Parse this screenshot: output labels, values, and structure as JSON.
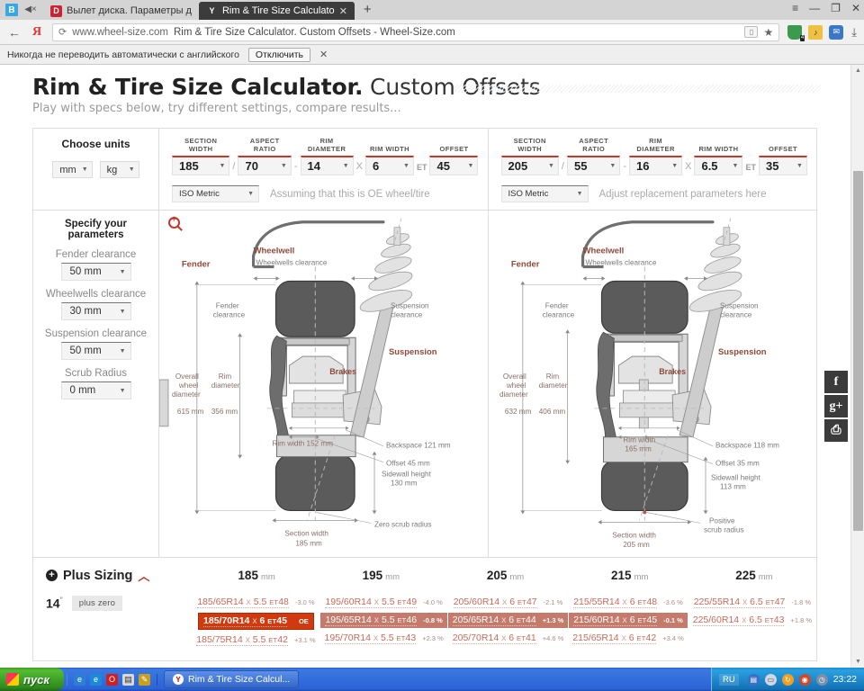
{
  "browser": {
    "tabs": [
      {
        "label": "Вылет диска. Параметры д",
        "favicon": "D",
        "active": false
      },
      {
        "label": "Rim & Tire Size Calculato",
        "favicon": "Y",
        "active": true
      }
    ],
    "new_tab_label": "+",
    "close_glyph": "✕",
    "window_controls": {
      "menu": "≡",
      "minimize": "—",
      "maximize": "❐",
      "close": "✕"
    },
    "back_arrow": "←",
    "yandex_logo": "Я",
    "reload_glyph": "⟳",
    "url_domain": "www.wheel-size.com",
    "url_title": "Rim & Tire Size Calculator. Custom Offsets - Wheel-Size.com",
    "star_glyph": "★",
    "download_glyph": "⤓",
    "extensions": [
      {
        "name": "adblock-shield",
        "glyph": "",
        "badge": "4"
      },
      {
        "name": "notes",
        "glyph": "♪"
      },
      {
        "name": "mail",
        "glyph": "✉"
      }
    ],
    "notice": {
      "text": "Никогда не переводить автоматически с английского",
      "button": "Отключить",
      "close": "✕"
    }
  },
  "header": {
    "title_bold": "Rim & Tire Size Calculator.",
    "title_light": " Custom Offsets",
    "subtitle": "Play with specs below, try different settings, compare results..."
  },
  "units": {
    "title": "Choose units",
    "length": "mm",
    "weight": "kg",
    "caret": "▼"
  },
  "specs": {
    "labels": {
      "section_width": "SECTION WIDTH",
      "aspect_ratio": "ASPECT RATIO",
      "rim_diameter": "RIM DIAMETER",
      "rim_width": "RIM WIDTH",
      "offset": "OFFSET"
    },
    "separators": {
      "slash": "/",
      "dash": "-",
      "times": "X",
      "et": "ET"
    },
    "oe": {
      "section_width": "185",
      "aspect_ratio": "70",
      "rim_diameter": "14",
      "rim_width": "6",
      "offset": "45",
      "standard": "ISO Metric",
      "hint": "Assuming that this is OE wheel/tire"
    },
    "replacement": {
      "section_width": "205",
      "aspect_ratio": "55",
      "rim_diameter": "16",
      "rim_width": "6.5",
      "offset": "35",
      "standard": "ISO Metric",
      "hint": "Adjust replacement parameters here"
    }
  },
  "parameters": {
    "title": "Specify your parameters",
    "items": [
      {
        "label": "Fender clearance",
        "value": "50 mm"
      },
      {
        "label": "Wheelwells clearance",
        "value": "30 mm"
      },
      {
        "label": "Suspension clearance",
        "value": "50 mm"
      },
      {
        "label": "Scrub Radius",
        "value": "0 mm"
      }
    ],
    "caret": "▼"
  },
  "diagram_left": {
    "fender": "Fender",
    "wheelwell": "Wheelwell",
    "wheelwells_clearance": "Wheelwells clearance",
    "fender_clearance": "Fender\nclearance",
    "suspension_clearance": "Suspension\nclearance",
    "suspension": "Suspension",
    "brakes": "Brakes",
    "overall_wheel_diameter": "Overall\nwheel\ndiameter",
    "overall_wheel_diameter_value": "615 mm",
    "rim_diameter": "Rim\ndiameter",
    "rim_diameter_value": "356 mm",
    "rim_width": "Rim width 152 mm",
    "backspace": "Backspace 121 mm",
    "offset": "Offset 45 mm",
    "sidewall_height": "Sidewall height\n130 mm",
    "section_width": "Section width\n185 mm",
    "scrub_radius": "Zero scrub radius"
  },
  "diagram_right": {
    "fender": "Fender",
    "wheelwell": "Wheelwell",
    "wheelwells_clearance": "Wheelwells clearance",
    "fender_clearance": "Fender\nclearance",
    "suspension_clearance": "Suspension\nclearance",
    "suspension": "Suspension",
    "brakes": "Brakes",
    "overall_wheel_diameter": "Overall\nwheel\ndiameter",
    "overall_wheel_diameter_value": "632 mm",
    "rim_diameter": "Rim\ndiameter",
    "rim_diameter_value": "406 mm",
    "rim_width": "Rim width\n165 mm",
    "backspace": "Backspace 118 mm",
    "offset": "Offset 35 mm",
    "sidewall_height": "Sidewall height\n113 mm",
    "section_width": "Section width\n205 mm",
    "scrub_radius": "Positive\nscrub radius"
  },
  "plus_sizing": {
    "title": "Plus Sizing",
    "plus_glyph": "+",
    "chevron": "︿",
    "rim_size": "14",
    "rim_unit": "\"",
    "badge": "plus zero",
    "unit_label": "mm",
    "columns": [
      {
        "width": "185",
        "rows": [
          {
            "spec": "185/65R14",
            "x": "x",
            "rim": "5.5",
            "et": "ET",
            "offset": "48",
            "pct": "-3.0 %",
            "state": "normal"
          },
          {
            "spec": "185/70R14",
            "x": "x",
            "rim": "6",
            "et": "ET",
            "offset": "45",
            "pct": "",
            "oe": "OE",
            "state": "oe"
          },
          {
            "spec": "185/75R14",
            "x": "x",
            "rim": "5.5",
            "et": "ET",
            "offset": "42",
            "pct": "+3.1 %",
            "state": "normal"
          }
        ]
      },
      {
        "width": "195",
        "rows": [
          {
            "spec": "195/60R14",
            "x": "x",
            "rim": "5.5",
            "et": "ET",
            "offset": "49",
            "pct": "-4.0 %",
            "state": "normal"
          },
          {
            "spec": "195/65R14",
            "x": "x",
            "rim": "5.5",
            "et": "ET",
            "offset": "46",
            "pct": "-0.8 %",
            "state": "selected"
          },
          {
            "spec": "195/70R14",
            "x": "x",
            "rim": "5.5",
            "et": "ET",
            "offset": "43",
            "pct": "+2.3 %",
            "state": "normal"
          }
        ]
      },
      {
        "width": "205",
        "rows": [
          {
            "spec": "205/60R14",
            "x": "x",
            "rim": "6",
            "et": "ET",
            "offset": "47",
            "pct": "-2.1 %",
            "state": "normal"
          },
          {
            "spec": "205/65R14",
            "x": "x",
            "rim": "6",
            "et": "ET",
            "offset": "44",
            "pct": "+1.3 %",
            "state": "selected"
          },
          {
            "spec": "205/70R14",
            "x": "x",
            "rim": "6",
            "et": "ET",
            "offset": "41",
            "pct": "+4.6 %",
            "state": "normal"
          }
        ]
      },
      {
        "width": "215",
        "rows": [
          {
            "spec": "215/55R14",
            "x": "x",
            "rim": "6",
            "et": "ET",
            "offset": "48",
            "pct": "-3.6 %",
            "state": "normal"
          },
          {
            "spec": "215/60R14",
            "x": "x",
            "rim": "6",
            "et": "ET",
            "offset": "45",
            "pct": "-0.1 %",
            "state": "selected"
          },
          {
            "spec": "215/65R14",
            "x": "x",
            "rim": "6",
            "et": "ET",
            "offset": "42",
            "pct": "+3.4 %",
            "state": "normal"
          }
        ]
      },
      {
        "width": "225",
        "rows": [
          {
            "spec": "225/55R14",
            "x": "x",
            "rim": "6.5",
            "et": "ET",
            "offset": "47",
            "pct": "-1.8 %",
            "state": "normal"
          },
          {
            "spec": "225/60R14",
            "x": "x",
            "rim": "6.5",
            "et": "ET",
            "offset": "43",
            "pct": "+1.8 %",
            "state": "normal"
          }
        ]
      }
    ]
  },
  "social": [
    {
      "name": "facebook",
      "glyph": "f"
    },
    {
      "name": "google-plus",
      "glyph": "g+"
    },
    {
      "name": "print",
      "glyph": "⎙"
    }
  ],
  "taskbar": {
    "start": "пуск",
    "quick_icons": [
      "e",
      "e",
      "O",
      "💾",
      "✎"
    ],
    "task_label": "Rim & Tire Size Calcul...",
    "task_icon": "Y",
    "language": "RU",
    "clock": "23:22"
  },
  "colors": {
    "accent_red": "#c0392b",
    "oe_red": "#d1390f",
    "selected_row": "#c47b6c",
    "spec_text": "#c86a5b"
  }
}
